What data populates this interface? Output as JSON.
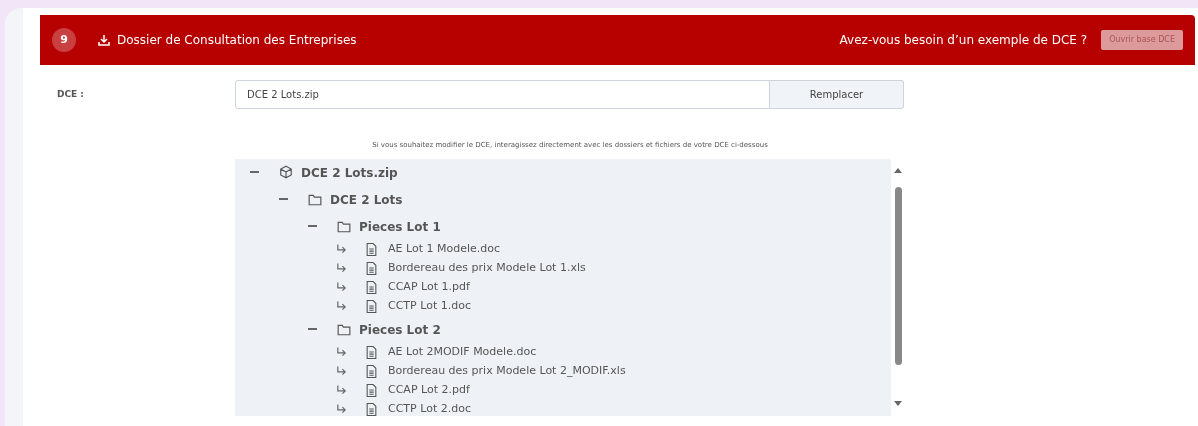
{
  "header": {
    "step": "9",
    "title": "Dossier de Consultation des Entreprises",
    "question": "Avez-vous besoin d’un exemple de DCE ?",
    "button": "Ouvrir base DCE"
  },
  "dce_field": {
    "label": "DCE :",
    "value": "DCE 2 Lots.zip",
    "button": "Remplacer"
  },
  "hint": "Si vous souhaitez modifier le DCE, interagissez directement avec les dossiers et fichiers de votre DCE ci-dessous",
  "tree": [
    {
      "kind": "archive",
      "label": "DCE 2 Lots.zip",
      "expanded": true,
      "children": [
        {
          "kind": "folder",
          "label": "DCE 2 Lots",
          "expanded": true,
          "children": [
            {
              "kind": "folder",
              "label": "Pieces Lot 1",
              "expanded": true,
              "children": [
                {
                  "kind": "file",
                  "label": "AE Lot 1 Modele.doc"
                },
                {
                  "kind": "file",
                  "label": "Bordereau des prix Modele Lot 1.xls"
                },
                {
                  "kind": "file",
                  "label": "CCAP Lot 1.pdf"
                },
                {
                  "kind": "file",
                  "label": "CCTP Lot 1.doc"
                }
              ]
            },
            {
              "kind": "folder",
              "label": "Pieces Lot 2",
              "expanded": true,
              "children": [
                {
                  "kind": "file",
                  "label": "AE Lot 2MODIF Modele.doc"
                },
                {
                  "kind": "file",
                  "label": "Bordereau des prix Modele Lot 2_MODIF.xls"
                },
                {
                  "kind": "file",
                  "label": "CCAP Lot 2.pdf"
                },
                {
                  "kind": "file",
                  "label": "CCTP Lot 2.doc"
                }
              ]
            }
          ]
        }
      ]
    }
  ]
}
